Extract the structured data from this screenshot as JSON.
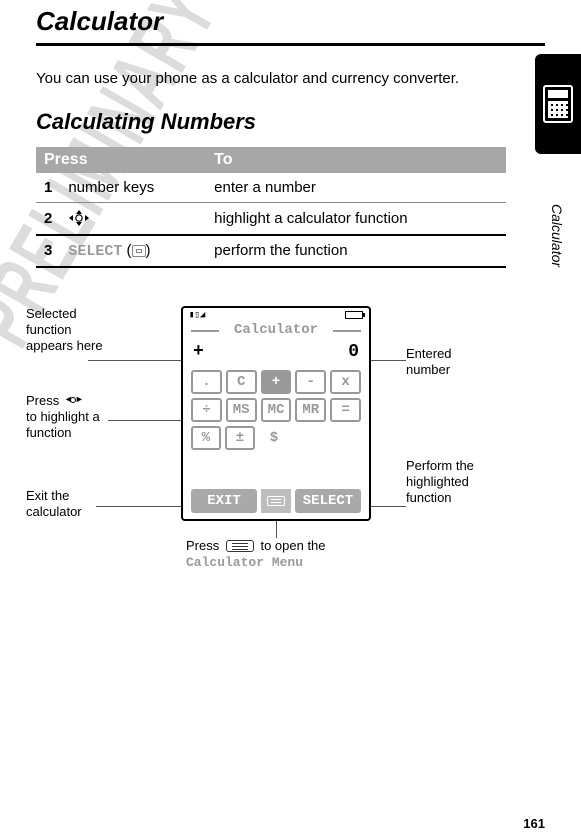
{
  "watermark": "PRELIMINARY",
  "page_number": "161",
  "side_label": "Calculator",
  "title": "Calculator",
  "intro": "You can use your phone as a calculator and currency converter.",
  "section_heading": "Calculating Numbers",
  "table": {
    "head_press": "Press",
    "head_to": "To",
    "rows": [
      {
        "n": "1",
        "press": "number keys",
        "to": "enter a number"
      },
      {
        "n": "2",
        "press_icon": "dpad",
        "to": "highlight a calculator function"
      },
      {
        "n": "3",
        "press_label": "SELECT",
        "press_suffix": " (",
        "press_icon": "softkey",
        "press_close": ")",
        "to": "perform the function"
      }
    ]
  },
  "diagram": {
    "screen_title": "Calculator",
    "selected_op": "+",
    "entered_value": "0",
    "key_rows": [
      [
        ".",
        "C",
        "+",
        "-",
        "x"
      ],
      [
        "÷",
        "MS",
        "MC",
        "MR",
        "="
      ],
      [
        "%",
        "±",
        "$"
      ]
    ],
    "dark_keys": [
      "+"
    ],
    "soft_left": "EXIT",
    "soft_right": "SELECT",
    "annotations": {
      "a1": "Selected function appears here",
      "a2_pre": "Press ",
      "a2_post": " to highlight a function",
      "a3": "Exit the calculator",
      "a4": "Entered number",
      "a5": "Perform the highlighted function",
      "a6_pre": "Press ",
      "a6_mid": " to open the ",
      "a6_label": "Calculator Menu"
    }
  }
}
